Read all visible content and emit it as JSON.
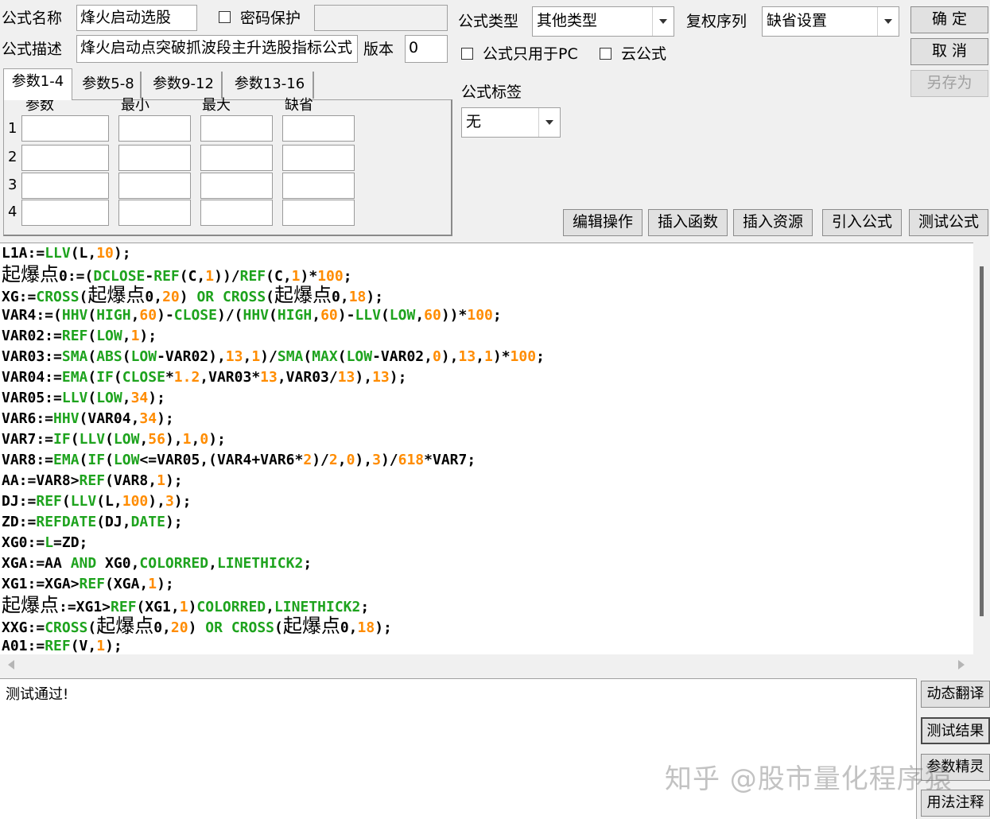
{
  "header": {
    "name_label": "公式名称",
    "name_value": "烽火启动选股",
    "password_label": "密码保护",
    "desc_label": "公式描述",
    "desc_value": "烽火启动点突破抓波段主升选股指标公式",
    "version_label": "版本",
    "version_value": "0",
    "type_label": "公式类型",
    "type_value": "其他类型",
    "restore_label": "复权序列",
    "restore_value": "缺省设置",
    "pc_only_label": "公式只用于PC",
    "cloud_label": "云公式",
    "tag_label": "公式标签",
    "tag_value": "无"
  },
  "buttons": {
    "ok": "确 定",
    "cancel": "取 消",
    "save_as": "另存为"
  },
  "tabs": [
    "参数1-4",
    "参数5-8",
    "参数9-12",
    "参数13-16"
  ],
  "params": {
    "headers": [
      "参数",
      "最小",
      "最大",
      "缺省"
    ],
    "rows": [
      "1",
      "2",
      "3",
      "4"
    ]
  },
  "toolbar": [
    "编辑操作",
    "插入函数",
    "插入资源",
    "引入公式",
    "测试公式"
  ],
  "code_lines": [
    [
      [
        "L1A:=",
        ""
      ],
      [
        "LLV",
        "f"
      ],
      [
        "(L,",
        ""
      ],
      [
        "10",
        "n"
      ],
      [
        ");",
        ""
      ]
    ],
    [
      [
        "起爆点",
        "cn"
      ],
      [
        "0:=(",
        ""
      ],
      [
        "DCLOSE",
        "f"
      ],
      [
        "-",
        ""
      ],
      [
        "REF",
        "f"
      ],
      [
        "(C,",
        ""
      ],
      [
        "1",
        "n"
      ],
      [
        "))/",
        ""
      ],
      [
        "REF",
        "f"
      ],
      [
        "(C,",
        ""
      ],
      [
        "1",
        "n"
      ],
      [
        ")*",
        ""
      ],
      [
        "100",
        "n"
      ],
      [
        ";",
        ""
      ]
    ],
    [
      [
        "XG:=",
        ""
      ],
      [
        "CROSS",
        "f"
      ],
      [
        "(",
        ""
      ],
      [
        "起爆点",
        "cn"
      ],
      [
        "0,",
        ""
      ],
      [
        "20",
        "n"
      ],
      [
        ") ",
        ""
      ],
      [
        "OR",
        "f"
      ],
      [
        " ",
        ""
      ],
      [
        "CROSS",
        "f"
      ],
      [
        "(",
        ""
      ],
      [
        "起爆点",
        "cn"
      ],
      [
        "0,",
        ""
      ],
      [
        "18",
        "n"
      ],
      [
        ");",
        ""
      ]
    ],
    [
      [
        "VAR4:=(",
        ""
      ],
      [
        "HHV",
        "f"
      ],
      [
        "(",
        ""
      ],
      [
        "HIGH",
        "f"
      ],
      [
        ",",
        ""
      ],
      [
        "60",
        "n"
      ],
      [
        ")-",
        ""
      ],
      [
        "CLOSE",
        "f"
      ],
      [
        ")/(",
        ""
      ],
      [
        "HHV",
        "f"
      ],
      [
        "(",
        ""
      ],
      [
        "HIGH",
        "f"
      ],
      [
        ",",
        ""
      ],
      [
        "60",
        "n"
      ],
      [
        ")-",
        ""
      ],
      [
        "LLV",
        "f"
      ],
      [
        "(",
        ""
      ],
      [
        "LOW",
        "f"
      ],
      [
        ",",
        ""
      ],
      [
        "60",
        "n"
      ],
      [
        "))*",
        ""
      ],
      [
        "100",
        "n"
      ],
      [
        ";",
        ""
      ]
    ],
    [
      [
        "VAR02:=",
        ""
      ],
      [
        "REF",
        "f"
      ],
      [
        "(",
        ""
      ],
      [
        "LOW",
        "f"
      ],
      [
        ",",
        ""
      ],
      [
        "1",
        "n"
      ],
      [
        ");",
        ""
      ]
    ],
    [
      [
        "VAR03:=",
        ""
      ],
      [
        "SMA",
        "f"
      ],
      [
        "(",
        ""
      ],
      [
        "ABS",
        "f"
      ],
      [
        "(",
        ""
      ],
      [
        "LOW",
        "f"
      ],
      [
        "-VAR02),",
        ""
      ],
      [
        "13",
        "n"
      ],
      [
        ",",
        ""
      ],
      [
        "1",
        "n"
      ],
      [
        ")/",
        ""
      ],
      [
        "SMA",
        "f"
      ],
      [
        "(",
        ""
      ],
      [
        "MAX",
        "f"
      ],
      [
        "(",
        ""
      ],
      [
        "LOW",
        "f"
      ],
      [
        "-VAR02,",
        ""
      ],
      [
        "0",
        "n"
      ],
      [
        "),",
        ""
      ],
      [
        "13",
        "n"
      ],
      [
        ",",
        ""
      ],
      [
        "1",
        "n"
      ],
      [
        ")*",
        ""
      ],
      [
        "100",
        "n"
      ],
      [
        ";",
        ""
      ]
    ],
    [
      [
        "VAR04:=",
        ""
      ],
      [
        "EMA",
        "f"
      ],
      [
        "(",
        ""
      ],
      [
        "IF",
        "f"
      ],
      [
        "(",
        ""
      ],
      [
        "CLOSE",
        "f"
      ],
      [
        "*",
        ""
      ],
      [
        "1.2",
        "n"
      ],
      [
        ",VAR03*",
        ""
      ],
      [
        "13",
        "n"
      ],
      [
        ",VAR03/",
        ""
      ],
      [
        "13",
        "n"
      ],
      [
        "),",
        ""
      ],
      [
        "13",
        "n"
      ],
      [
        ");",
        ""
      ]
    ],
    [
      [
        "VAR05:=",
        ""
      ],
      [
        "LLV",
        "f"
      ],
      [
        "(",
        ""
      ],
      [
        "LOW",
        "f"
      ],
      [
        ",",
        ""
      ],
      [
        "34",
        "n"
      ],
      [
        ");",
        ""
      ]
    ],
    [
      [
        "VAR6:=",
        ""
      ],
      [
        "HHV",
        "f"
      ],
      [
        "(VAR04,",
        ""
      ],
      [
        "34",
        "n"
      ],
      [
        ");",
        ""
      ]
    ],
    [
      [
        "VAR7:=",
        ""
      ],
      [
        "IF",
        "f"
      ],
      [
        "(",
        ""
      ],
      [
        "LLV",
        "f"
      ],
      [
        "(",
        ""
      ],
      [
        "LOW",
        "f"
      ],
      [
        ",",
        ""
      ],
      [
        "56",
        "n"
      ],
      [
        "),",
        ""
      ],
      [
        "1",
        "n"
      ],
      [
        ",",
        ""
      ],
      [
        "0",
        "n"
      ],
      [
        ");",
        ""
      ]
    ],
    [
      [
        "VAR8:=",
        ""
      ],
      [
        "EMA",
        "f"
      ],
      [
        "(",
        ""
      ],
      [
        "IF",
        "f"
      ],
      [
        "(",
        ""
      ],
      [
        "LOW",
        "f"
      ],
      [
        "<=VAR05,(VAR4+VAR6*",
        ""
      ],
      [
        "2",
        "n"
      ],
      [
        ")/",
        ""
      ],
      [
        "2",
        "n"
      ],
      [
        ",",
        ""
      ],
      [
        "0",
        "n"
      ],
      [
        "),",
        ""
      ],
      [
        "3",
        "n"
      ],
      [
        ")/",
        ""
      ],
      [
        "618",
        "n"
      ],
      [
        "*VAR7;",
        ""
      ]
    ],
    [
      [
        "AA:=VAR8>",
        ""
      ],
      [
        "REF",
        "f"
      ],
      [
        "(VAR8,",
        ""
      ],
      [
        "1",
        "n"
      ],
      [
        ");",
        ""
      ]
    ],
    [
      [
        "DJ:=",
        ""
      ],
      [
        "REF",
        "f"
      ],
      [
        "(",
        ""
      ],
      [
        "LLV",
        "f"
      ],
      [
        "(L,",
        ""
      ],
      [
        "100",
        "n"
      ],
      [
        "),",
        ""
      ],
      [
        "3",
        "n"
      ],
      [
        ");",
        ""
      ]
    ],
    [
      [
        "ZD:=",
        ""
      ],
      [
        "REFDATE",
        "f"
      ],
      [
        "(DJ,",
        ""
      ],
      [
        "DATE",
        "f"
      ],
      [
        ");",
        ""
      ]
    ],
    [
      [
        "XG0:=",
        ""
      ],
      [
        "L",
        "f"
      ],
      [
        "=ZD;",
        ""
      ]
    ],
    [
      [
        "XGA:=AA ",
        ""
      ],
      [
        "AND",
        "f"
      ],
      [
        " XG0,",
        ""
      ],
      [
        "COLORRED",
        "f"
      ],
      [
        ",",
        ""
      ],
      [
        "LINETHICK2",
        "f"
      ],
      [
        ";",
        ""
      ]
    ],
    [
      [
        "XG1:=XGA>",
        ""
      ],
      [
        "REF",
        "f"
      ],
      [
        "(XGA,",
        ""
      ],
      [
        "1",
        "n"
      ],
      [
        ");",
        ""
      ]
    ],
    [
      [
        "起爆点",
        "cn"
      ],
      [
        ":=XG1>",
        ""
      ],
      [
        "REF",
        "f"
      ],
      [
        "(XG1,",
        ""
      ],
      [
        "1",
        "n"
      ],
      [
        ")",
        ""
      ],
      [
        "COLORRED",
        "f"
      ],
      [
        ",",
        ""
      ],
      [
        "LINETHICK2",
        "f"
      ],
      [
        ";",
        ""
      ]
    ],
    [
      [
        "XXG:=",
        ""
      ],
      [
        "CROSS",
        "f"
      ],
      [
        "(",
        ""
      ],
      [
        "起爆点",
        "cn"
      ],
      [
        "0,",
        ""
      ],
      [
        "20",
        "n"
      ],
      [
        ") ",
        ""
      ],
      [
        "OR",
        "f"
      ],
      [
        " ",
        ""
      ],
      [
        "CROSS",
        "f"
      ],
      [
        "(",
        ""
      ],
      [
        "起爆点",
        "cn"
      ],
      [
        "0,",
        ""
      ],
      [
        "18",
        "n"
      ],
      [
        ");",
        ""
      ]
    ],
    [
      [
        "A01:=",
        ""
      ],
      [
        "REF",
        "f"
      ],
      [
        "(V,",
        ""
      ],
      [
        "1",
        "n"
      ],
      [
        ");",
        ""
      ]
    ]
  ],
  "output_text": "测试通过!",
  "side_buttons": [
    "动态翻译",
    "测试结果",
    "参数精灵",
    "用法注释"
  ],
  "watermark": "知乎 @股市量化程序猿",
  "colors": {
    "function": "#1ea31e",
    "number": "#ff8c00"
  }
}
